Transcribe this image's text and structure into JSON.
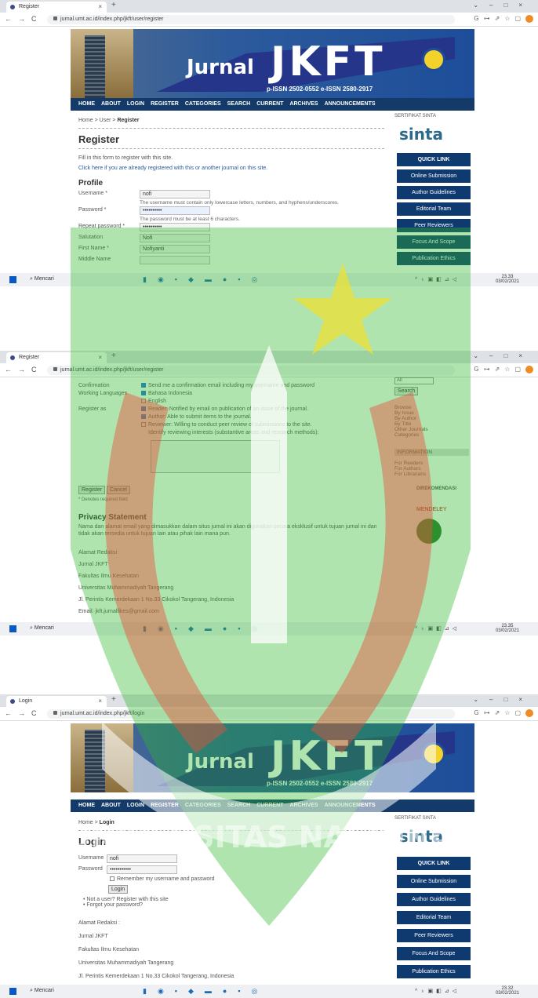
{
  "panel1": {
    "tab_title": "Register",
    "url": "jurnal.umt.ac.id/index.php/jkft/user/register",
    "breadcrumb": {
      "home": "Home",
      "user": "User",
      "current": "Register"
    },
    "title": "Register",
    "intro": "Fill in this form to register with this site.",
    "intro2": "Click here if you are already registered with this or another journal on this site.",
    "section": "Profile",
    "fields": [
      {
        "label": "Username *",
        "value": "nofi",
        "hint": "The username must contain only lowercase letters, numbers, and hyphens/underscores."
      },
      {
        "label": "Password *",
        "value": "••••••••••",
        "hint": "The password must be at least 6 characters."
      },
      {
        "label": "Repeat password *",
        "value": "••••••••••"
      },
      {
        "label": "Salutation",
        "value": "Nofi"
      },
      {
        "label": "First Name *",
        "value": "Nofiyanti"
      },
      {
        "label": "Middle Name",
        "value": ""
      }
    ],
    "taskbar_search": "Mencari",
    "time": "23.33",
    "date": "03/02/2021"
  },
  "header": {
    "jurnal": "Jurnal",
    "jkft": "JKFT",
    "issn": "p-ISSN 2502-0552  e-ISSN 2580-2917",
    "menu": [
      "HOME",
      "ABOUT",
      "LOGIN",
      "REGISTER",
      "CATEGORIES",
      "SEARCH",
      "CURRENT",
      "ARCHIVES",
      "ANNOUNCEMENTS"
    ]
  },
  "sidebar": {
    "sinta_title": "SERTIFIKAT SINTA",
    "sinta_logo": "sinta",
    "links": [
      "QUICK LINK",
      "Online Submission",
      "Author Guidelines",
      "Editorial Team",
      "Peer Reviewers",
      "Focus And Scope",
      "Publication Ethics"
    ]
  },
  "panel2": {
    "tab_title": "Register",
    "url": "jurnal.umt.ac.id/index.php/jkft/user/register",
    "confirmation_label": "Confirmation",
    "confirmation_text": "Send me a confirmation email including my username and password",
    "working_lang_label": "Working Languages",
    "lang_options": [
      "Bahasa Indonesia",
      "English"
    ],
    "register_as_label": "Register as",
    "register_options": [
      "Reader: Notified by email on publication of an issue of the journal.",
      "Author: Able to submit items to the journal.",
      "Reviewer: Willing to conduct peer review of submissions to the site."
    ],
    "reviewer_note": "Identify reviewing interests (substantive areas and research methods):",
    "register_btn": "Register",
    "cancel_btn": "Cancel",
    "required_note": "* Denotes required field",
    "privacy_title": "Privacy Statement",
    "privacy_text": "Nama dan alamat email yang dimasukkan dalam situs jurnal ini akan digunakan secara eksklusif untuk tujuan jurnal ini dan tidak akan tersedia untuk tujuan lain atau pihak lain mana pun.",
    "address": [
      "Alamat Redaksi :",
      "Jurnal JKFT",
      "Fakultas Ilmu Kesehatan",
      "Universitas Muhammadiyah Tangerang",
      "Jl. Perintis Kemerdekaan 1 No.33 Cikokol Tangerang, Indonesia",
      "Email: jkft.jurnalfikes@gmail.com"
    ],
    "side_select": "All",
    "side_search": "Search",
    "browse_title": "Browse",
    "browse": [
      "By Issue",
      "By Author",
      "By Title",
      "Other Journals",
      "Categories"
    ],
    "info_title": "INFORMATION",
    "info": [
      "For Readers",
      "For Authors",
      "For Librarians"
    ],
    "direkomendasi": "DIREKOMENDASI",
    "mendeley": "MENDELEY",
    "taskbar_search": "Mencari",
    "time": "23.35",
    "date": "03/02/2021"
  },
  "panel3": {
    "tab_title": "Login",
    "url": "jurnal.umt.ac.id/index.php/jkft/login",
    "breadcrumb": {
      "home": "Home",
      "current": "Login"
    },
    "title": "Login",
    "username_label": "Username",
    "username_value": "nofi",
    "password_label": "Password",
    "password_value": "•••••••••••",
    "remember": "Remember my username and password",
    "login_btn": "Login",
    "links": [
      "Not a user? Register with this site",
      "Forgot your password?"
    ],
    "address": [
      "Alamat Redaksi :",
      "Jurnal JKFT",
      "Fakultas Ilmu Kesehatan",
      "Universitas Muhammadiyah Tangerang",
      "Jl. Perintis Kemerdekaan 1 No.33 Cikokol Tangerang, Indonesia"
    ],
    "taskbar_search": "Mencari",
    "time": "23.32",
    "date": "03/02/2021"
  },
  "watermark_text": "UNIVERSITAS NASIONAL"
}
